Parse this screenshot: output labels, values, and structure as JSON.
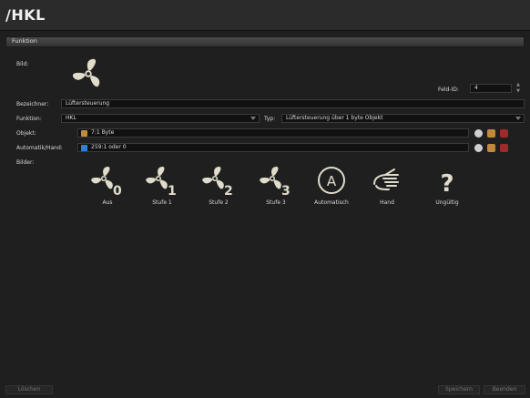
{
  "window": {
    "title": "/HKL"
  },
  "section": {
    "label": "Funktion"
  },
  "form": {
    "bild_label": "Bild:",
    "feldid_label": "Feld-ID:",
    "feldid_value": "4",
    "bezeichner_label": "Bezeichner:",
    "bezeichner_value": "Lüftersteuerung",
    "funktion_label": "Funktion:",
    "funktion_value": "HKL",
    "typ_label": "Typ:",
    "typ_value": "Lüftersteuerung über 1 byte Objekt",
    "objekt_label": "Objekt:",
    "objekt_value": "7:1 Byte",
    "automatik_label": "Automatik/Hand:",
    "automatik_value": "259:1 oder 0",
    "bilder_label": "Bilder:"
  },
  "images": [
    {
      "label": "Aus",
      "icon": "fan-0-icon",
      "digit": "0"
    },
    {
      "label": "Stufe 1",
      "icon": "fan-1-icon",
      "digit": "1"
    },
    {
      "label": "Stufe 2",
      "icon": "fan-2-icon",
      "digit": "2"
    },
    {
      "label": "Stufe 3",
      "icon": "fan-3-icon",
      "digit": "3"
    },
    {
      "label": "Automatisch",
      "icon": "automatic-a-icon",
      "glyph": "A"
    },
    {
      "label": "Hand",
      "icon": "hand-icon"
    },
    {
      "label": "Ungültig",
      "icon": "question-mark-icon",
      "glyph": "?"
    }
  ],
  "buttons": {
    "delete": "Löschen",
    "save": "Speichern",
    "quit": "Beenden"
  },
  "colors": {
    "background": "#1f1f1f",
    "field": "#111111",
    "icon": "#e0dccb",
    "object_icon": "#c08a3a",
    "automatik_icon": "#2f7fd6"
  }
}
